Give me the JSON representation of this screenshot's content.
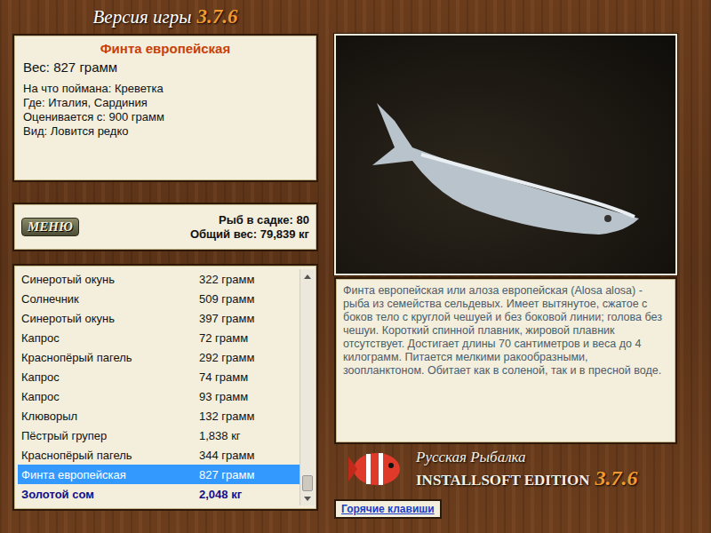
{
  "header": {
    "title": "Версия игры",
    "version": "3.7.6"
  },
  "fish_card": {
    "name": "Финта европейская",
    "weight": "Вес: 827 грамм",
    "details": [
      "На что поймана: Креветка",
      "Где: Италия, Сардиния",
      "Оценивается с: 900 грамм",
      "Вид: Ловится редко"
    ]
  },
  "summary": {
    "menu_button": "МЕНЮ",
    "count": "Рыб в садке: 80",
    "total": "Общий вес: 79,839 кг"
  },
  "catch_list": {
    "scroll_level": 1,
    "rows": [
      {
        "name": "Синеротый окунь",
        "weight": "322 грамм",
        "selected": false,
        "highlighted": false
      },
      {
        "name": "Солнечник",
        "weight": "509 грамм",
        "selected": false,
        "highlighted": false
      },
      {
        "name": "Синеротый окунь",
        "weight": "397 грамм",
        "selected": false,
        "highlighted": false
      },
      {
        "name": "Капрос",
        "weight": "72 грамм",
        "selected": false,
        "highlighted": false
      },
      {
        "name": "Краснопёрый пагель",
        "weight": "292 грамм",
        "selected": false,
        "highlighted": false
      },
      {
        "name": "Капрос",
        "weight": "74 грамм",
        "selected": false,
        "highlighted": false
      },
      {
        "name": "Капрос",
        "weight": "93 грамм",
        "selected": false,
        "highlighted": false
      },
      {
        "name": "Клюворыл",
        "weight": "132 грамм",
        "selected": false,
        "highlighted": false
      },
      {
        "name": "Пёстрый групер",
        "weight": "1,838 кг",
        "selected": false,
        "highlighted": false
      },
      {
        "name": "Краснопёрый пагель",
        "weight": "344 грамм",
        "selected": false,
        "highlighted": false
      },
      {
        "name": "Финта европейская",
        "weight": "827 грамм",
        "selected": true,
        "highlighted": false
      },
      {
        "name": "Золотой сом",
        "weight": "2,048 кг",
        "selected": false,
        "highlighted": true
      }
    ]
  },
  "description": "Финта европейская или алоза европейская (Alosa alosa) - рыба из семейства сельдевых. Имеет вытянутое, сжатое с боков тело с круглой чешуей и без боковой линии; голова без чешуи. Короткий спинной плавник, жировой плавник отсутствует. Достигает длины 70 сантиметров и веса до 4 килограмм. Питается мелкими ракообразными, зоопланктоном. Обитает как в соленой, так и в пресной воде.",
  "logo": {
    "title": "Русская Рыбалка",
    "edition": "INSTALLSOFT EDITION",
    "version": "3.7.6"
  },
  "hotkeys_link": "Горячие клавиши"
}
